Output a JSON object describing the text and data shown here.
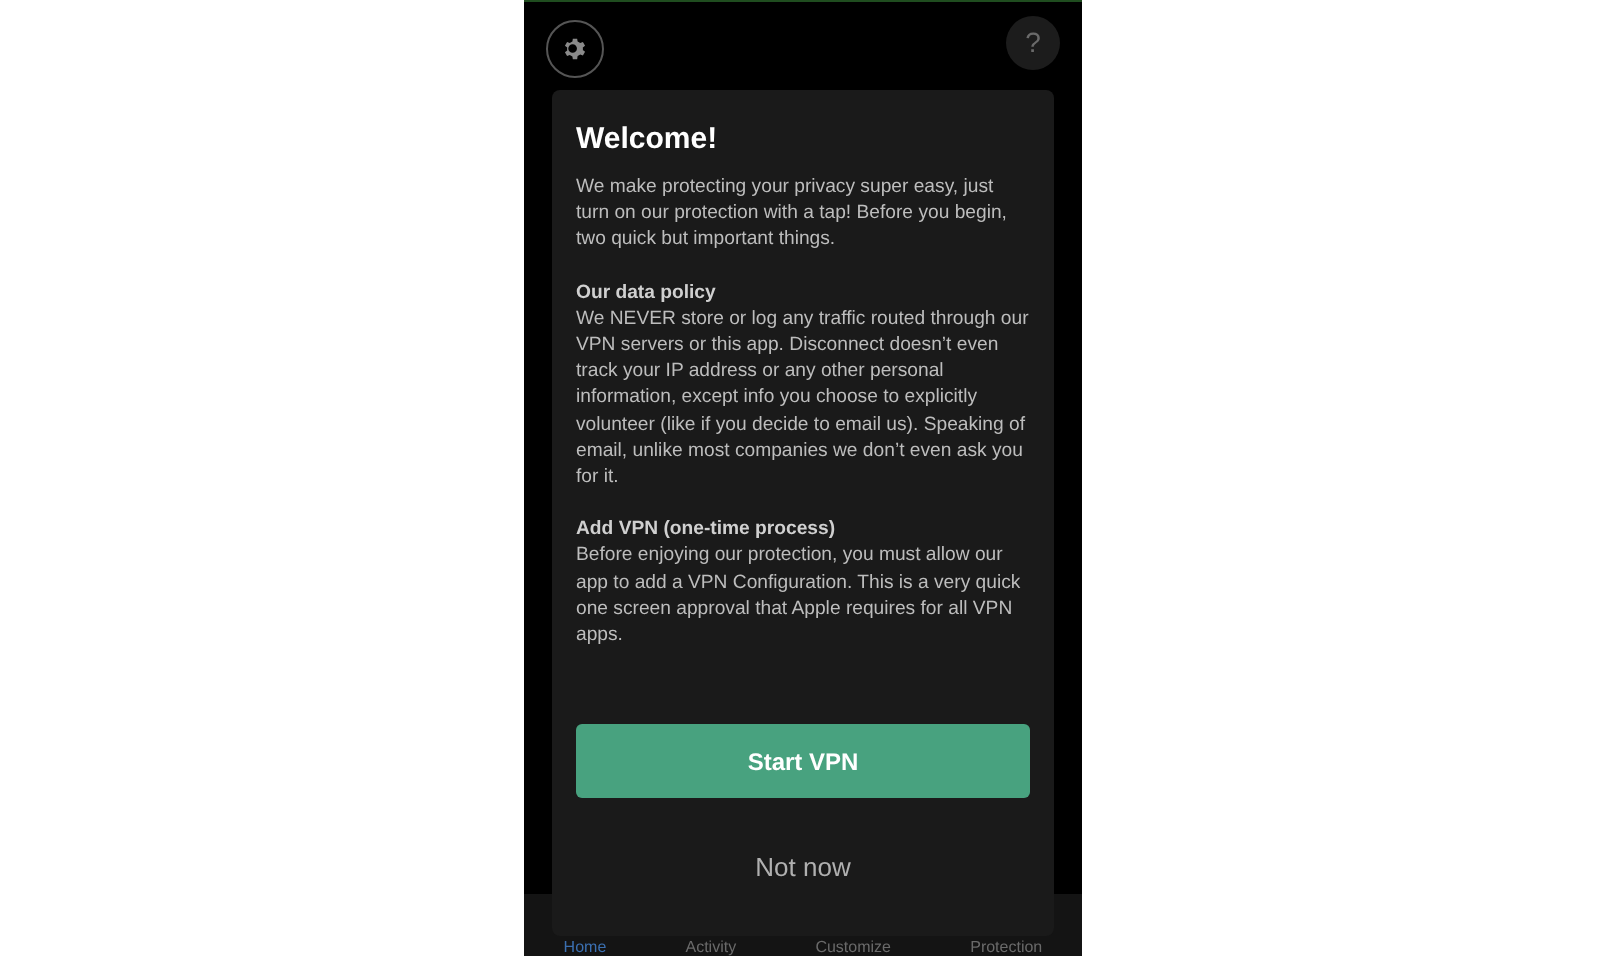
{
  "dialog": {
    "title": "Welcome!",
    "intro": "We make protecting your privacy super easy, just turn on our protection with a tap!  Before you begin, two quick but important things.",
    "sections": [
      {
        "heading": "Our data policy",
        "body": "We NEVER store or log any traffic routed through our VPN servers or this app. Disconnect doesn’t even track your IP address or any other personal information, except info you choose to explicitly volunteer (like if you decide to email us). Speaking of email, unlike most companies we don’t even ask you for it."
      },
      {
        "heading": "Add VPN (one-time process)",
        "body": "Before enjoying our protection, you must allow our app to add a VPN Configuration. This is a very quick one screen approval that Apple requires for all VPN apps."
      }
    ],
    "primary_button": "Start VPN",
    "secondary_button": "Not now"
  },
  "top_bar": {
    "help": "?"
  },
  "tab_bar": [
    {
      "label": "Home",
      "selected": true
    },
    {
      "label": "Activity",
      "selected": false
    },
    {
      "label": "Customize",
      "selected": false
    },
    {
      "label": "Protection",
      "selected": false
    }
  ]
}
